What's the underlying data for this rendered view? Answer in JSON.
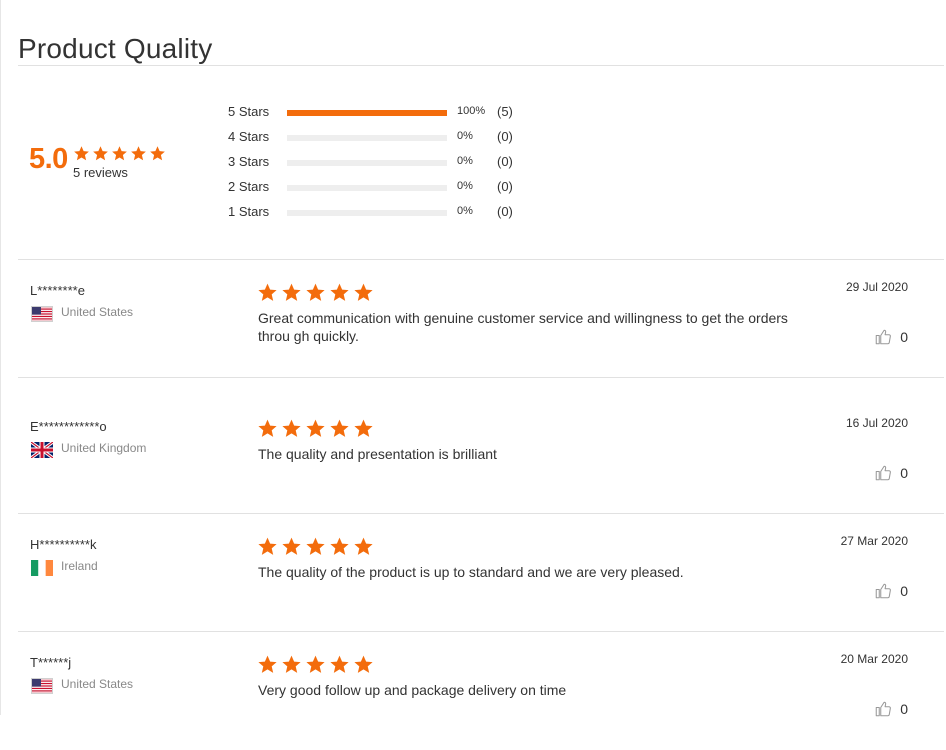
{
  "section_title": "Product Quality",
  "summary": {
    "average": "5.0",
    "average_stars": 5,
    "count_text": "5 reviews",
    "star_color": "#f36c0c",
    "distribution": [
      {
        "label": "5 Stars",
        "percent_text": "100%",
        "count_text": "(5)",
        "fraction": 1.0
      },
      {
        "label": "4 Stars",
        "percent_text": "0%",
        "count_text": "(0)",
        "fraction": 0
      },
      {
        "label": "3 Stars",
        "percent_text": "0%",
        "count_text": "(0)",
        "fraction": 0
      },
      {
        "label": "2 Stars",
        "percent_text": "0%",
        "count_text": "(0)",
        "fraction": 0
      },
      {
        "label": "1 Stars",
        "percent_text": "0%",
        "count_text": "(0)",
        "fraction": 0
      }
    ]
  },
  "reviews": [
    {
      "reviewer": "L********e",
      "country": "United States",
      "flag": "us-flag-icon",
      "rating": 5,
      "date": "29 Jul 2020",
      "text": "Great communication with genuine customer service and willingness to get the orders throu gh quickly.",
      "helpful": "0"
    },
    {
      "reviewer": "E************o",
      "country": "United Kingdom",
      "flag": "uk-flag-icon",
      "rating": 5,
      "date": "16 Jul 2020",
      "text": "The quality and presentation is brilliant",
      "helpful": "0"
    },
    {
      "reviewer": "H**********k",
      "country": "Ireland",
      "flag": "ireland-flag-icon",
      "rating": 5,
      "date": "27 Mar 2020",
      "text": "The quality of the product is up to standard and we are very pleased.",
      "helpful": "0"
    },
    {
      "reviewer": "T******j",
      "country": "United States",
      "flag": "us-flag-icon",
      "rating": 5,
      "date": "20 Mar 2020",
      "text": "Very good follow up and package delivery on time",
      "helpful": "0"
    }
  ]
}
